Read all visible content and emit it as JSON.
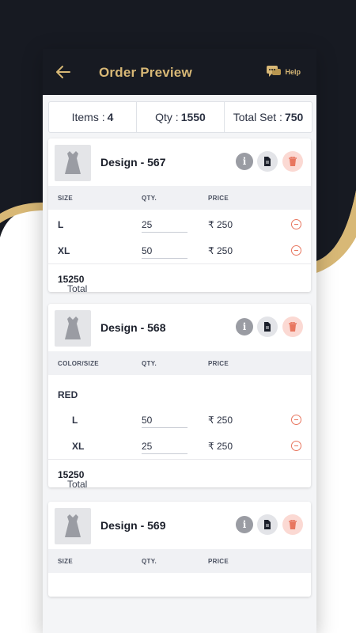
{
  "colors": {
    "dark": "#171a22",
    "gold": "#d8b876",
    "delete": "#e8765f"
  },
  "header": {
    "title": "Order Preview",
    "help_label": "Help",
    "back_icon": "arrow-left-icon",
    "help_icon": "chat-bubble-icon"
  },
  "summary": {
    "items_label": "Items :",
    "items_value": "4",
    "qty_label": "Qty :",
    "qty_value": "1550",
    "total_set_label": "Total Set :",
    "total_set_value": "750"
  },
  "cards": [
    {
      "name": "Design - 567",
      "col1": "SIZE",
      "col2": "QTY.",
      "col3": "PRICE",
      "rows": [
        {
          "size": "L",
          "qty": "25",
          "price": "₹ 250"
        },
        {
          "size": "XL",
          "qty": "50",
          "price": "₹ 250"
        }
      ],
      "total_label": "Total Quantity :",
      "total_value": "15250"
    },
    {
      "name": "Design - 568",
      "col1": "COLOR/SIZE",
      "col2": "QTY.",
      "col3": "PRICE",
      "color": "RED",
      "rows": [
        {
          "size": "L",
          "qty": "50",
          "price": "₹ 250"
        },
        {
          "size": "XL",
          "qty": "25",
          "price": "₹ 250"
        }
      ],
      "total_label": "Total Quantity :",
      "total_value": "15250"
    },
    {
      "name": "Design - 569",
      "col1": "SIZE",
      "col2": "QTY.",
      "col3": "PRICE"
    }
  ]
}
